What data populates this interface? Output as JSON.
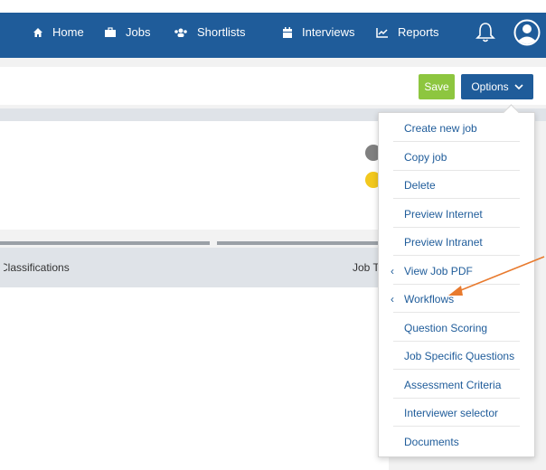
{
  "nav": {
    "home": "Home",
    "jobs": "Jobs",
    "shortlists": "Shortlists",
    "interviews": "Interviews",
    "reports": "Reports"
  },
  "actions": {
    "save": "Save",
    "options": "Options"
  },
  "table": {
    "col_classifications": "Classifications",
    "col_job": "Job T"
  },
  "menu": {
    "items": [
      {
        "label": "Create new job",
        "chevron": false
      },
      {
        "label": "Copy job",
        "chevron": false
      },
      {
        "label": "Delete",
        "chevron": false
      },
      {
        "label": "Preview Internet",
        "chevron": false
      },
      {
        "label": "Preview Intranet",
        "chevron": false
      },
      {
        "label": "View Job PDF",
        "chevron": true
      },
      {
        "label": "Workflows",
        "chevron": true
      },
      {
        "label": "Question Scoring",
        "chevron": false
      },
      {
        "label": "Job Specific Questions",
        "chevron": false
      },
      {
        "label": "Assessment Criteria",
        "chevron": false
      },
      {
        "label": "Interviewer selector",
        "chevron": false
      },
      {
        "label": "Documents",
        "chevron": false
      }
    ]
  },
  "colors": {
    "nav_bg": "#1f5c9a",
    "save_bg": "#8dc63f",
    "link": "#1f5c9a",
    "annotation_arrow": "#e87a2e"
  },
  "icons": [
    "home-icon",
    "briefcase-icon",
    "users-icon",
    "calendar-icon",
    "chart-icon",
    "bell-icon",
    "user-circle-icon",
    "chevron-down-icon",
    "chevron-left-icon"
  ]
}
